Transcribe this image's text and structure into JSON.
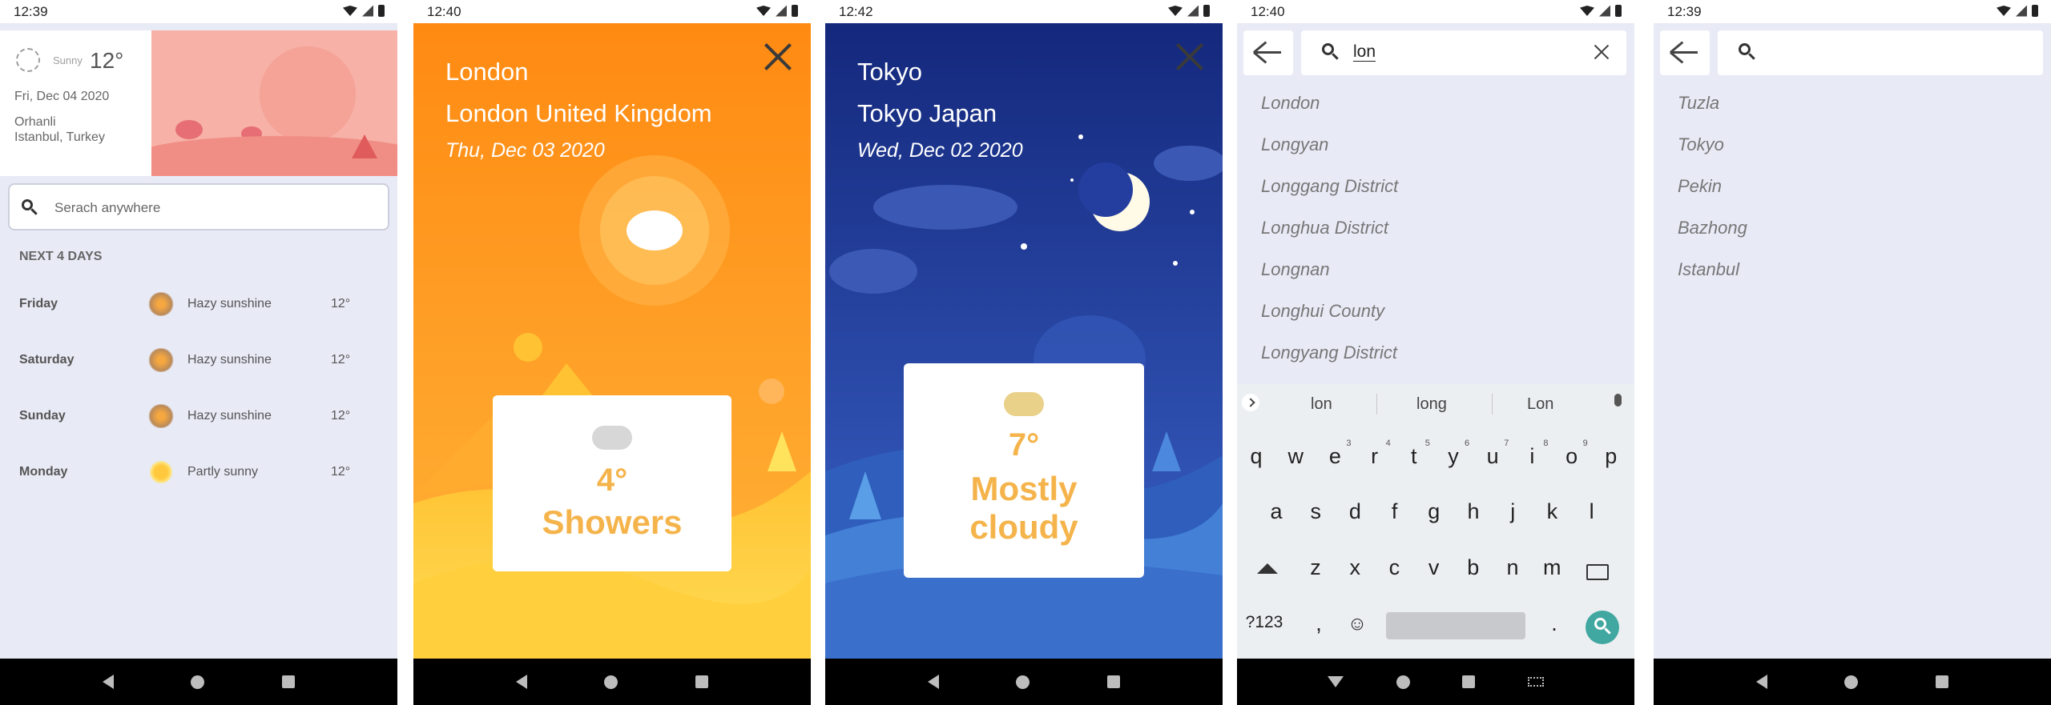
{
  "screens": [
    {
      "time": "12:39",
      "current": {
        "condition": "Sunny",
        "temperature": "12°",
        "date": "Fri, Dec 04 2020",
        "district": "Orhanli",
        "city": "Istanbul, Turkey"
      },
      "search_placeholder": "Serach anywhere",
      "next_days_title": "NEXT 4 DAYS",
      "forecast": [
        {
          "day": "Friday",
          "condition": "Hazy sunshine",
          "temp": "12°",
          "icon": "hazy-sun-icon"
        },
        {
          "day": "Saturday",
          "condition": "Hazy sunshine",
          "temp": "12°",
          "icon": "hazy-sun-icon"
        },
        {
          "day": "Sunday",
          "condition": "Hazy sunshine",
          "temp": "12°",
          "icon": "hazy-sun-icon"
        },
        {
          "day": "Monday",
          "condition": "Partly sunny",
          "temp": "12°",
          "icon": "partly-sunny-icon"
        }
      ]
    },
    {
      "time": "12:40",
      "city": "London",
      "full_name": "London United Kingdom",
      "date": "Thu, Dec 03 2020",
      "temperature": "4°",
      "condition": "Showers",
      "icon": "showers-icon"
    },
    {
      "time": "12:42",
      "city": "Tokyo",
      "full_name": "Tokyo Japan",
      "date": "Wed, Dec 02 2020",
      "temperature": "7°",
      "condition_line1": "Mostly",
      "condition_line2": "cloudy",
      "icon": "mostly-cloudy-icon"
    },
    {
      "time": "12:40",
      "query": "lon",
      "results": [
        "London",
        "Longyan",
        "Longgang District",
        "Longhua District",
        "Longnan",
        "Longhui County",
        "Longyang District"
      ],
      "keyboard": {
        "suggestions": [
          "lon",
          "long",
          "Lon"
        ],
        "row1": [
          "q",
          "w",
          "e",
          "r",
          "t",
          "y",
          "u",
          "i",
          "o",
          "p"
        ],
        "row1_hints": [
          "",
          "",
          "3",
          "4",
          "5",
          "6",
          "7",
          "8",
          "9",
          ""
        ],
        "row2": [
          "a",
          "s",
          "d",
          "f",
          "g",
          "h",
          "j",
          "k",
          "l"
        ],
        "row3": [
          "z",
          "x",
          "c",
          "v",
          "b",
          "n",
          "m"
        ],
        "symbols_key": "?123",
        "comma_key": ",",
        "period_key": "."
      }
    },
    {
      "time": "12:39",
      "query": "",
      "results": [
        "Tuzla",
        "Tokyo",
        "Pekin",
        "Bazhong",
        "Istanbul"
      ]
    }
  ],
  "colors": {
    "list_bg": "#e8eaf6",
    "london_bg": "#ff9a1e",
    "tokyo_bg": "#1a2f8a",
    "card_accent": "#f5b44b",
    "search_key": "#41a7a1"
  }
}
